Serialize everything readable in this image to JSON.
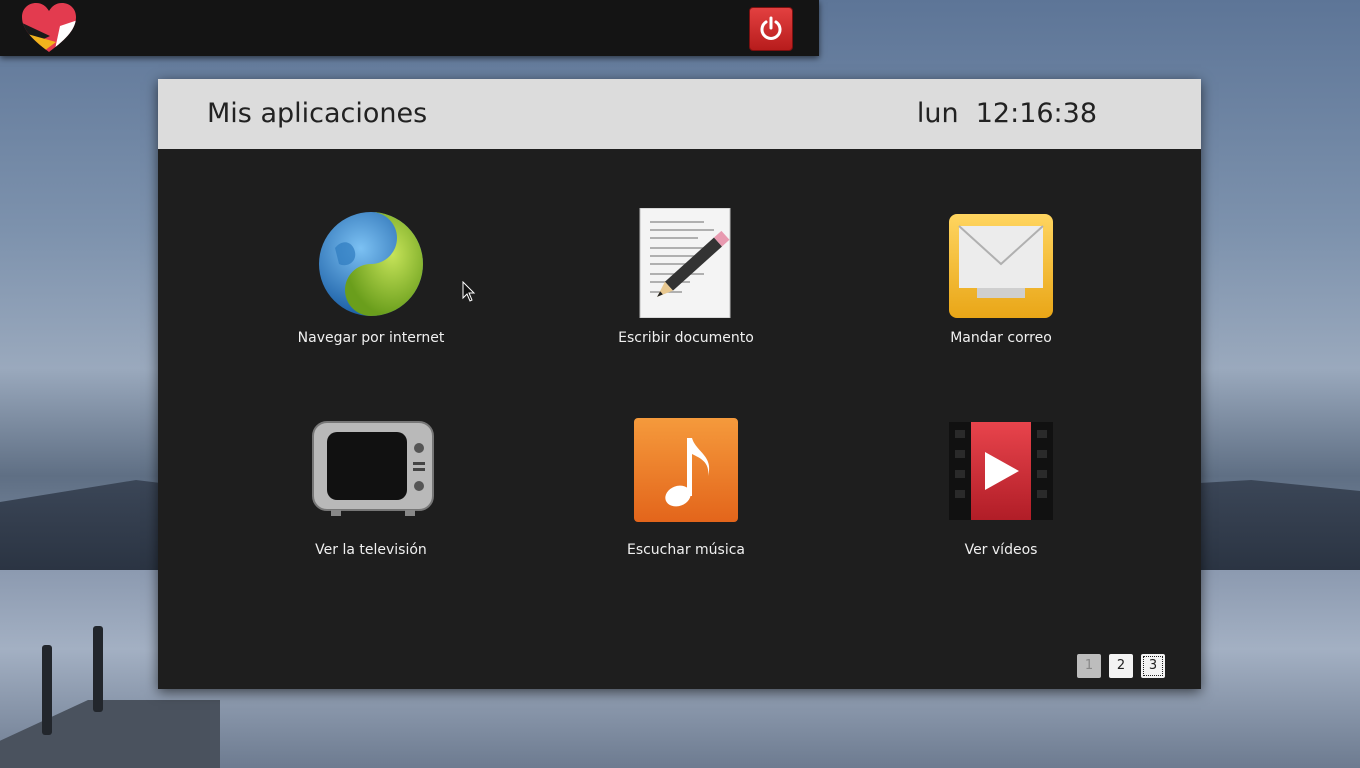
{
  "window": {
    "title": "Mis aplicaciones",
    "clock": "lun  12:16:38"
  },
  "apps": [
    {
      "label": "Navegar por internet",
      "icon": "globe-icon"
    },
    {
      "label": "Escribir documento",
      "icon": "document-pencil-icon"
    },
    {
      "label": "Mandar correo",
      "icon": "mail-icon"
    },
    {
      "label": "Ver la televisión",
      "icon": "tv-icon"
    },
    {
      "label": "Escuchar música",
      "icon": "music-note-icon"
    },
    {
      "label": "Ver vídeos",
      "icon": "video-play-icon"
    }
  ],
  "pager": {
    "pages": [
      "1",
      "2",
      "3"
    ],
    "current": "3"
  },
  "colors": {
    "accent_power": "#c62828",
    "window_bg": "#1e1e1e",
    "header_bg": "#dcdcdc"
  }
}
